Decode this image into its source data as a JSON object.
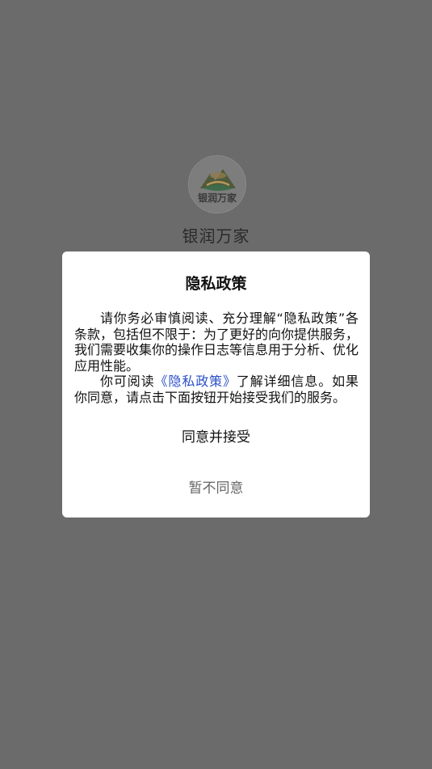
{
  "app": {
    "name": "银润万家",
    "logo_text": "银润万家"
  },
  "dialog": {
    "title": "隐私政策",
    "para1": "请你务必审慎阅读、充分理解“隐私政策”各条款，包括但不限于：为了更好的向你提供服务，我们需要收集你的操作日志等信息用于分析、优化应用性能。",
    "para2_prefix": "你可阅读",
    "para2_link": "《隐私政策》",
    "para2_suffix": "了解详细信息。如果你同意，请点击下面按钮开始接受我们的服务。",
    "agree_label": "同意并接受",
    "disagree_label": "暂不同意"
  },
  "colors": {
    "overlay": "#6b6b6b",
    "dialog_bg": "#ffffff",
    "link": "#2b4fc7"
  }
}
